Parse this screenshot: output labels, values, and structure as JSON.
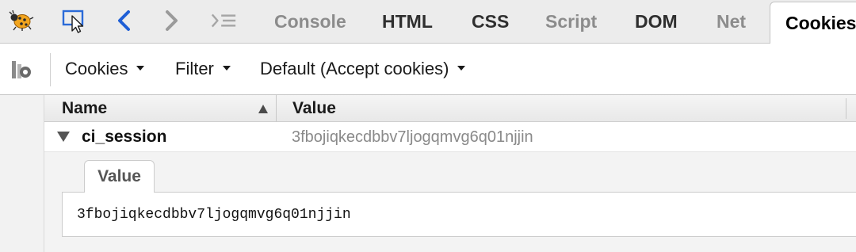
{
  "colors": {
    "toolbar_bg": "#ececec",
    "inactive_tab": "#8c8c8c",
    "active_tab": "#000000",
    "nav_arrow_blue": "#1f5fd6",
    "value_gray": "#8a8a8a",
    "panel_bg": "#f3f3f3"
  },
  "topbar": {
    "icons": [
      "firebug-bug-icon",
      "inspect-element-icon",
      "back-arrow-icon",
      "forward-arrow-icon",
      "command-line-icon"
    ],
    "tabs": [
      {
        "label": "Console",
        "state": "inactive"
      },
      {
        "label": "HTML",
        "state": "dark"
      },
      {
        "label": "CSS",
        "state": "dark"
      },
      {
        "label": "Script",
        "state": "inactive"
      },
      {
        "label": "DOM",
        "state": "dark"
      },
      {
        "label": "Net",
        "state": "inactive"
      },
      {
        "label": "Cookies",
        "state": "active"
      }
    ]
  },
  "toolbar": {
    "icon": "cookie-settings-icon",
    "menus": [
      {
        "label": "Cookies"
      },
      {
        "label": "Filter"
      },
      {
        "label": "Default (Accept cookies)"
      }
    ]
  },
  "table": {
    "columns": {
      "name": "Name",
      "value": "Value"
    },
    "sort": "ascending",
    "rows": [
      {
        "name": "ci_session",
        "value": "3fbojiqkecdbbv7ljogqmvg6q01njjin",
        "expanded": true
      }
    ]
  },
  "detail": {
    "tab_label": "Value",
    "content": "3fbojiqkecdbbv7ljogqmvg6q01njjin"
  }
}
